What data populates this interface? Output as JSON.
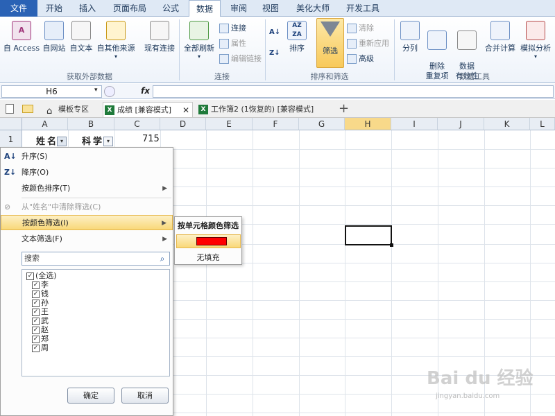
{
  "ribbon_tabs": [
    "文件",
    "开始",
    "插入",
    "页面布局",
    "公式",
    "数据",
    "审阅",
    "视图",
    "美化大师",
    "开发工具"
  ],
  "ribbon": {
    "get_external": {
      "buttons": [
        "自 Access",
        "自网站",
        "自文本",
        "自其他来源",
        "现有连接"
      ],
      "label": "获取外部数据"
    },
    "connections": {
      "refresh": "全部刷新",
      "connect": "连接",
      "properties": "属性",
      "edit_links": "编辑链接",
      "label": "连接"
    },
    "sort_filter": {
      "sort": "排序",
      "filter": "筛选",
      "clear": "清除",
      "reapply": "重新应用",
      "advanced": "高级",
      "label": "排序和筛选"
    },
    "data_tools": {
      "split": "分列",
      "remove_dup": "删除\n重复项",
      "validation": "数据\n有效性",
      "consolidate": "合并计算",
      "whatif": "模拟分析",
      "label": "数据工具"
    }
  },
  "formula_bar": {
    "name_box": "H6",
    "fx": "fx",
    "formula": ""
  },
  "workbook_tabs": [
    {
      "label": "模板专区"
    },
    {
      "label": "成绩  [兼容模式]"
    },
    {
      "label": "工作簿2 (1恢复的)  [兼容模式]"
    }
  ],
  "grid": {
    "columns": [
      "A",
      "B",
      "C",
      "D",
      "E",
      "F",
      "G",
      "H",
      "I",
      "J",
      "K",
      "L"
    ],
    "rows": [
      "1"
    ],
    "a1": "姓名",
    "b1": "科学",
    "c1": "715"
  },
  "filter_menu": {
    "sort_asc": "升序(S)",
    "sort_desc": "降序(O)",
    "sort_color": "按颜色排序(T)",
    "clear_filter": "从\"姓名\"中清除筛选(C)",
    "filter_color": "按颜色筛选(I)",
    "text_filter": "文本筛选(F)",
    "search_placeholder": "搜索",
    "items": [
      "(全选)",
      "李",
      "钱",
      "孙",
      "王",
      "武",
      "赵",
      "郑",
      "周"
    ],
    "ok": "确定",
    "cancel": "取消"
  },
  "color_submenu": {
    "header": "按单元格颜色筛选",
    "swatch_color": "#ff0000",
    "no_fill": "无填充"
  },
  "watermark": "Bai du 经验",
  "watermark_url": "jingyan.baidu.com"
}
